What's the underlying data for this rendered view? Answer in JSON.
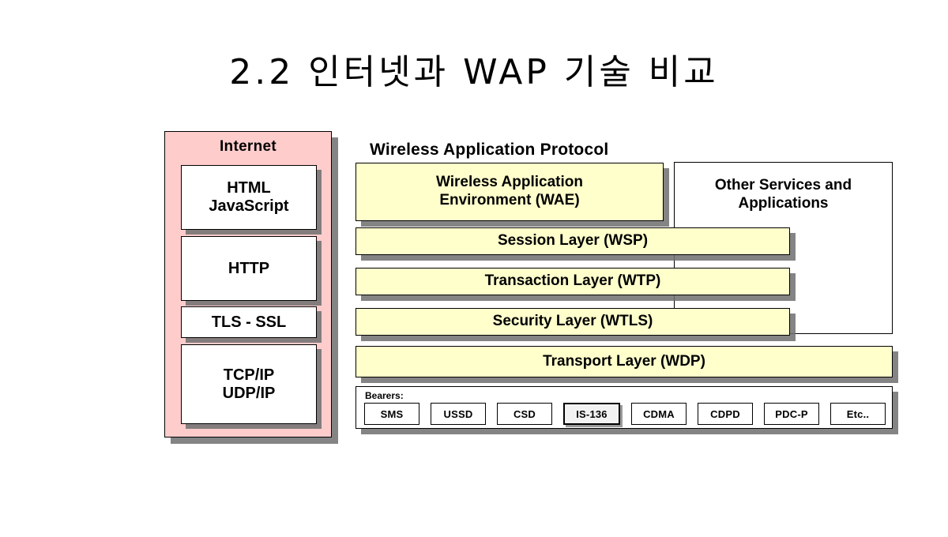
{
  "slide": {
    "title": "2.2 인터넷과 WAP 기술 비교",
    "background_color": "#ffffff"
  },
  "colors": {
    "internet_panel": "#ffcccc",
    "wap_layer": "#ffffcc",
    "box_white": "#ffffff",
    "shadow": "#6e6e6e",
    "outline": "#000000"
  },
  "internet_panel": {
    "title": "Internet",
    "boxes": [
      {
        "label": "HTML\nJavaScript"
      },
      {
        "label": "HTTP"
      },
      {
        "label": "TLS - SSL"
      },
      {
        "label": "TCP/IP\nUDP/IP"
      }
    ]
  },
  "wap": {
    "heading": "Wireless Application Protocol",
    "other_services_label": "Other Services and Applications",
    "layers": [
      {
        "label": "Wireless Application Environment (WAE)"
      },
      {
        "label": "Session Layer (WSP)"
      },
      {
        "label": "Transaction Layer (WTP)"
      },
      {
        "label": "Security Layer (WTLS)"
      },
      {
        "label": "Transport Layer (WDP)"
      }
    ],
    "bearers": {
      "label": "Bearers:",
      "items": [
        {
          "label": "SMS",
          "emphasis": false
        },
        {
          "label": "USSD",
          "emphasis": false
        },
        {
          "label": "CSD",
          "emphasis": false
        },
        {
          "label": "IS-136",
          "emphasis": true
        },
        {
          "label": "CDMA",
          "emphasis": false
        },
        {
          "label": "CDPD",
          "emphasis": false
        },
        {
          "label": "PDC-P",
          "emphasis": false
        },
        {
          "label": "Etc..",
          "emphasis": false
        }
      ]
    }
  }
}
